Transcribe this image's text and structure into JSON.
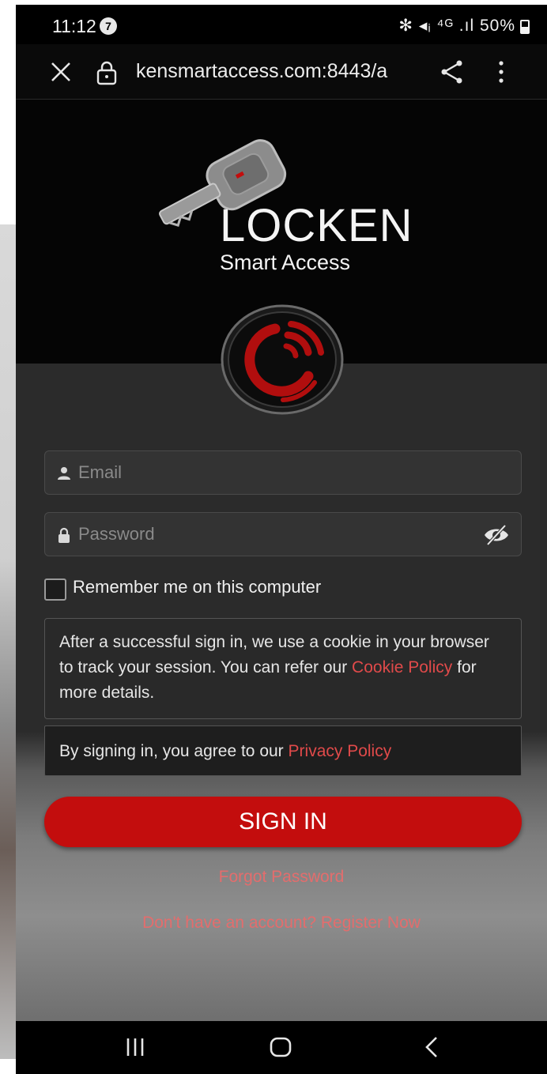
{
  "status_bar": {
    "time": "11:12",
    "notification_count": "7",
    "indicators": "✻ ◂ᵢ ⁴ᴳ .ıl",
    "battery": "50%"
  },
  "browser": {
    "url": "kensmartaccess.com:8443/a"
  },
  "brand": {
    "name": "LOCKEN",
    "subtitle": "Smart Access"
  },
  "login_form": {
    "email_placeholder": "Email",
    "password_placeholder": "Password",
    "remember_label": "Remember me on this computer",
    "cookie_text_before": "After a successful sign in, we use a cookie in your browser to track your session. You can refer our",
    "cookie_link": "Cookie Policy",
    "cookie_text_after": "for more details.",
    "privacy_text": "By signing in, you agree to our",
    "privacy_link": "Privacy Policy",
    "sign_in_label": "SIGN IN",
    "forgot_label": "Forgot Password",
    "register_label": "Don't have an account? Register Now"
  },
  "colors": {
    "accent": "#c30d0d",
    "link": "#e36d6d",
    "background": "#000000",
    "panel": "#2b2b2b"
  },
  "icons": [
    "close-icon",
    "lock-icon",
    "share-icon",
    "menu-icon",
    "person-icon",
    "padlock-icon",
    "eye-hidden-icon",
    "recent-apps-icon",
    "home-icon",
    "back-icon"
  ]
}
